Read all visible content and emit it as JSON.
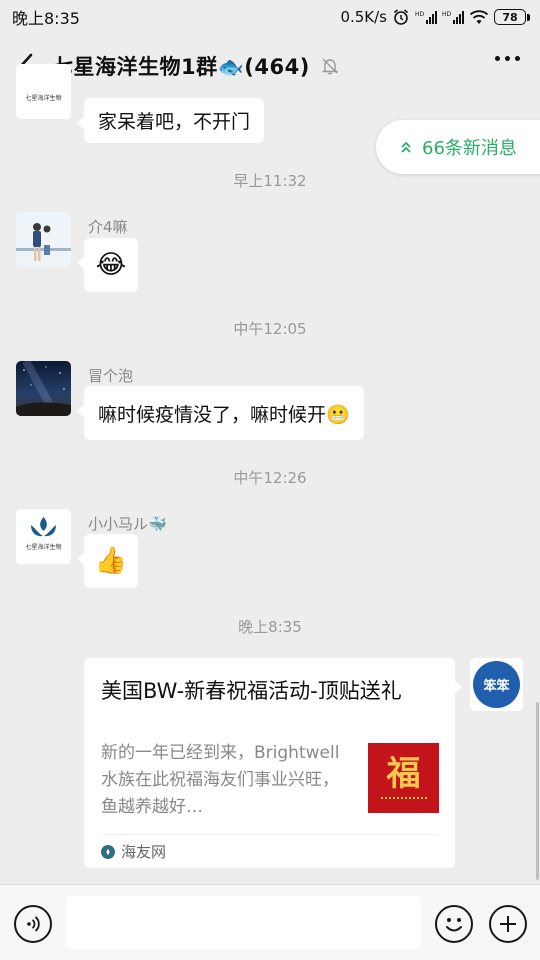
{
  "status_bar": {
    "time": "晚上8:35",
    "network_speed": "0.5K/s",
    "battery": "78",
    "icons": [
      "alarm-icon",
      "signal-hd-icon",
      "signal-hd-icon",
      "wifi-icon",
      "battery-icon"
    ]
  },
  "header": {
    "title": "七星海洋生物1群🐟(464)",
    "muted": true
  },
  "new_messages": {
    "label": "66条新消息",
    "color": "#2aae67"
  },
  "messages": [
    {
      "type": "text",
      "sender": "",
      "avatar": "logo-avatar",
      "text": "家呆着吧，不开门"
    },
    {
      "type": "timestamp",
      "text": "早上11:32"
    },
    {
      "type": "emoji",
      "sender": "介4嘛",
      "avatar": "couple-photo-avatar",
      "text": "😂"
    },
    {
      "type": "timestamp",
      "text": "中午12:05"
    },
    {
      "type": "text",
      "sender": "冒个泡",
      "avatar": "night-sky-avatar",
      "text": "嘛时候疫情没了，嘛时候开😬"
    },
    {
      "type": "timestamp",
      "text": "中午12:26"
    },
    {
      "type": "emoji",
      "sender": "小小马ル🐳",
      "avatar": "logo-avatar",
      "text": "👍"
    },
    {
      "type": "timestamp",
      "text": "晚上8:35"
    }
  ],
  "link_card": {
    "title": "美国BW-新春祝福活动-顶贴送礼",
    "description": "新的一年已经到来，Brightwell水族在此祝福海友们事业兴旺，鱼越养越好…",
    "source": "海友网",
    "thumbnail_char": "福"
  },
  "logo_avatar_text": "七星海洋生物",
  "self_avatar_text": "笨笨",
  "input": {
    "value": "",
    "placeholder": ""
  },
  "colors": {
    "background": "#ededed",
    "bubble": "#ffffff",
    "accent": "#2aae67"
  }
}
